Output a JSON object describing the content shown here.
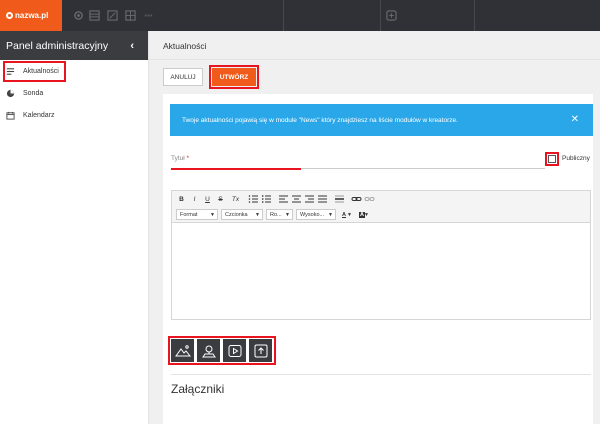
{
  "topbar": {
    "brand": "nazwa.pl",
    "icons": [
      "settings-icon",
      "grid-icon",
      "resize-icon",
      "layout-icon",
      "more-icon",
      "add-icon"
    ]
  },
  "sidebar": {
    "title": "Panel administracyjny",
    "collapse_icon": "‹",
    "items": [
      {
        "label": "Aktualności",
        "icon": "list-icon"
      },
      {
        "label": "Sonda",
        "icon": "pie-chart-icon"
      },
      {
        "label": "Kalendarz",
        "icon": "calendar-icon"
      }
    ]
  },
  "main": {
    "title": "Aktualności",
    "cancel_label": "ANULUJ",
    "create_label": "UTWÓRZ",
    "alert_text": "Twoje aktualności pojawią się w module \"News\" który znajdziesz na liście modułów w kreatorze.",
    "alert_close": "✕",
    "title_label": "Tytuł",
    "title_required": "*",
    "public_label": "Publiczny",
    "public_checked": false,
    "editor": {
      "buttons": [
        "B",
        "I",
        "U",
        "S",
        "Tx",
        "list-ol",
        "list-ul",
        "align-left",
        "align-center",
        "align-right",
        "align-justify",
        "hr",
        "link",
        "unlink"
      ],
      "selects": [
        {
          "label": "Format"
        },
        {
          "label": "Czcionka"
        },
        {
          "label": "Ro..."
        },
        {
          "label": "Wysoko..."
        }
      ],
      "text_color": "A",
      "bg_color": "A"
    },
    "insert_buttons": [
      "image-icon",
      "map-pin-icon",
      "video-icon",
      "upload-icon"
    ],
    "attachments_title": "Załączniki"
  },
  "colors": {
    "accent": "#f05a1a",
    "highlight": "#e8141f",
    "alert": "#2aa7e8",
    "dark": "#3a3c40"
  }
}
